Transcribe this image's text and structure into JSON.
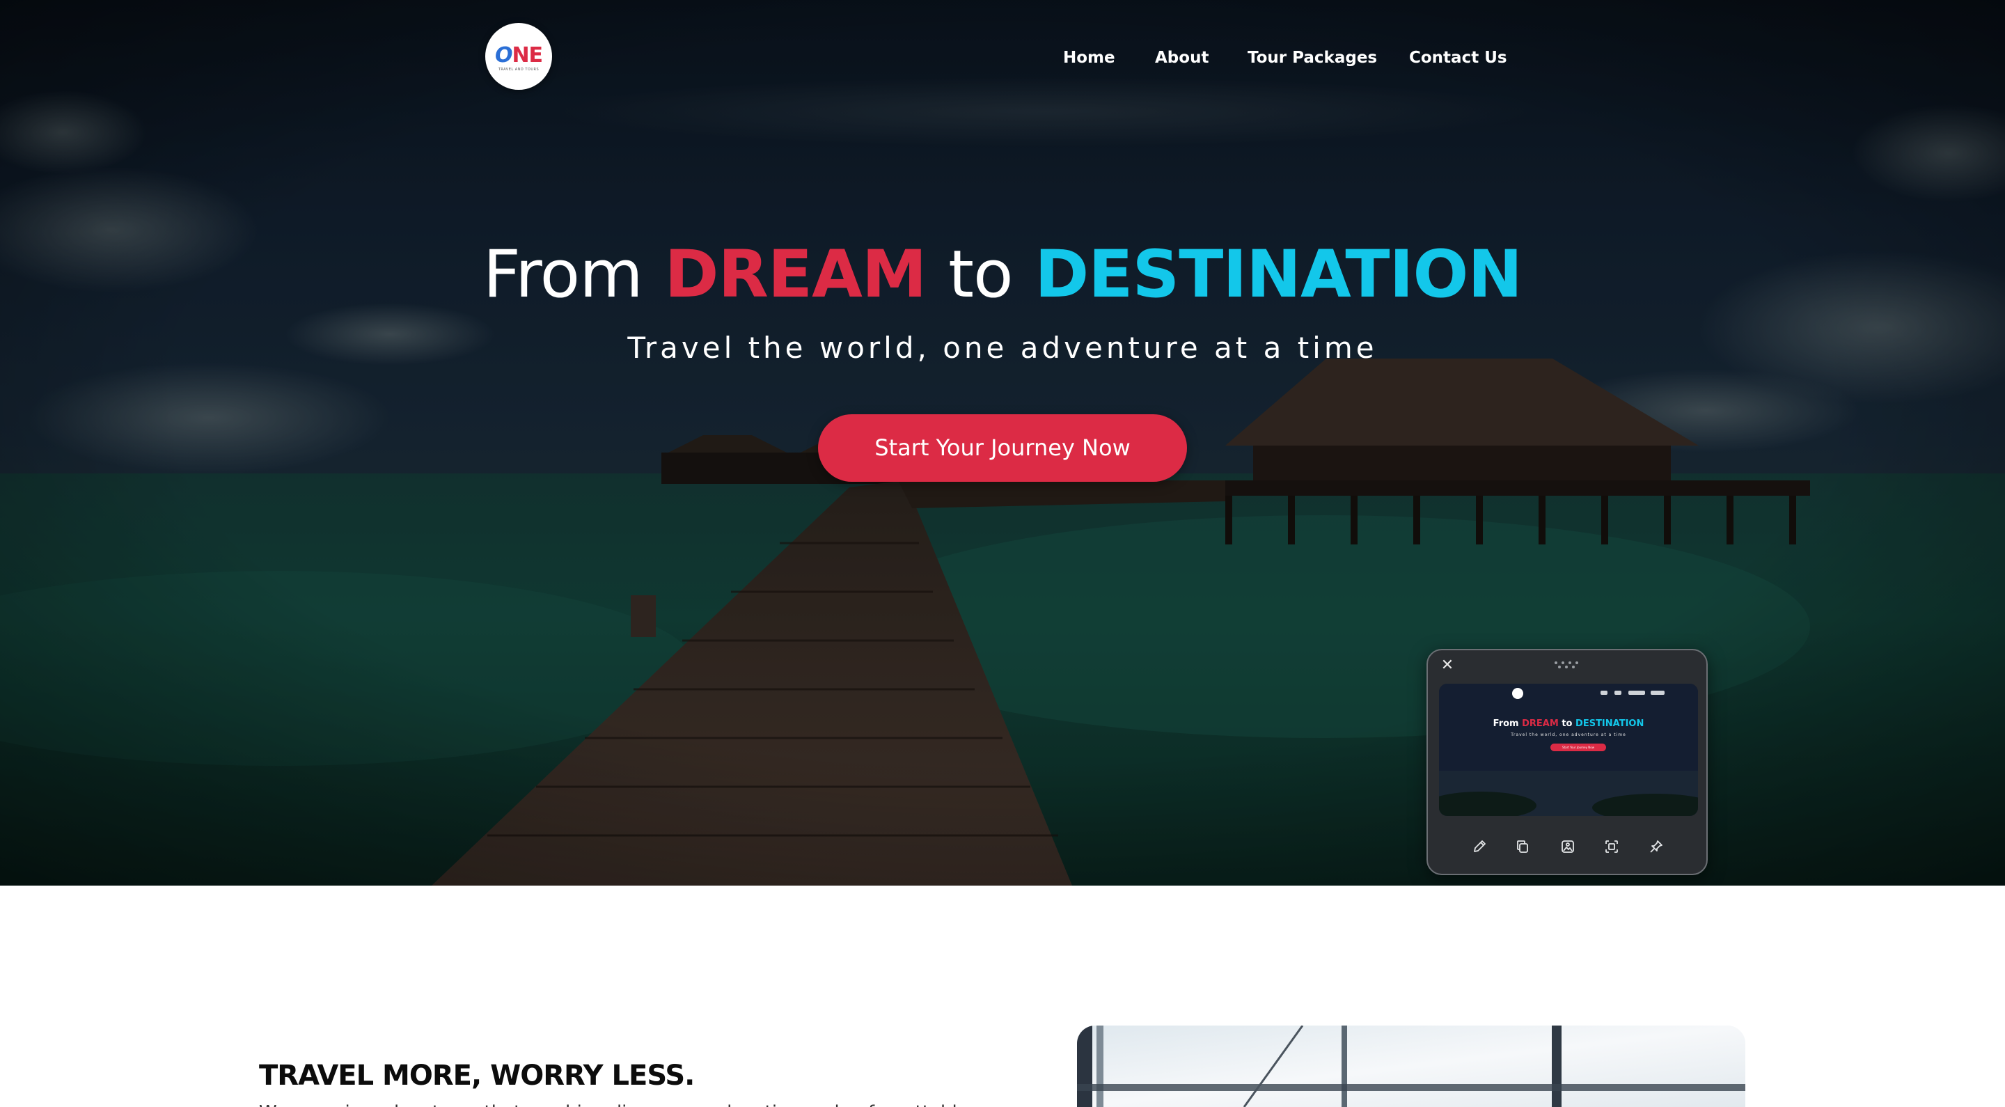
{
  "brand": {
    "logo_main_o": "O",
    "logo_main_ne": "NE",
    "logo_tagline": "TRAVEL AND TOURS"
  },
  "nav": {
    "items": [
      {
        "label": "Home"
      },
      {
        "label": "About"
      },
      {
        "label": "Tour Packages"
      },
      {
        "label": "Contact Us"
      }
    ]
  },
  "hero": {
    "title_from": "From",
    "title_dream": "DREAM",
    "title_to": "to",
    "title_destination": "DESTINATION",
    "subtitle": "Travel the world, one adventure at a time",
    "cta_label": "Start Your Journey Now"
  },
  "widget": {
    "close_glyph": "✕",
    "preview": {
      "title_from": "From",
      "title_dream": "DREAM",
      "title_to": "to",
      "title_destination": "DESTINATION",
      "subtitle": "Travel the world, one adventure at a time",
      "cta_label": "Start Your Journey Now"
    },
    "tools": [
      "pen-icon",
      "copy-icon",
      "image-icon",
      "screenshot-icon",
      "pin-icon"
    ]
  },
  "about": {
    "heading": "TRAVEL MORE, WORRY LESS.",
    "body": "We organize adventures that combine discovery, relaxation and unforgettable travel"
  },
  "colors": {
    "accent_red": "#dc2b45",
    "accent_cyan": "#13c7ea",
    "hero_overlay": "#0a1620",
    "widget_bg": "#2a2d31"
  }
}
